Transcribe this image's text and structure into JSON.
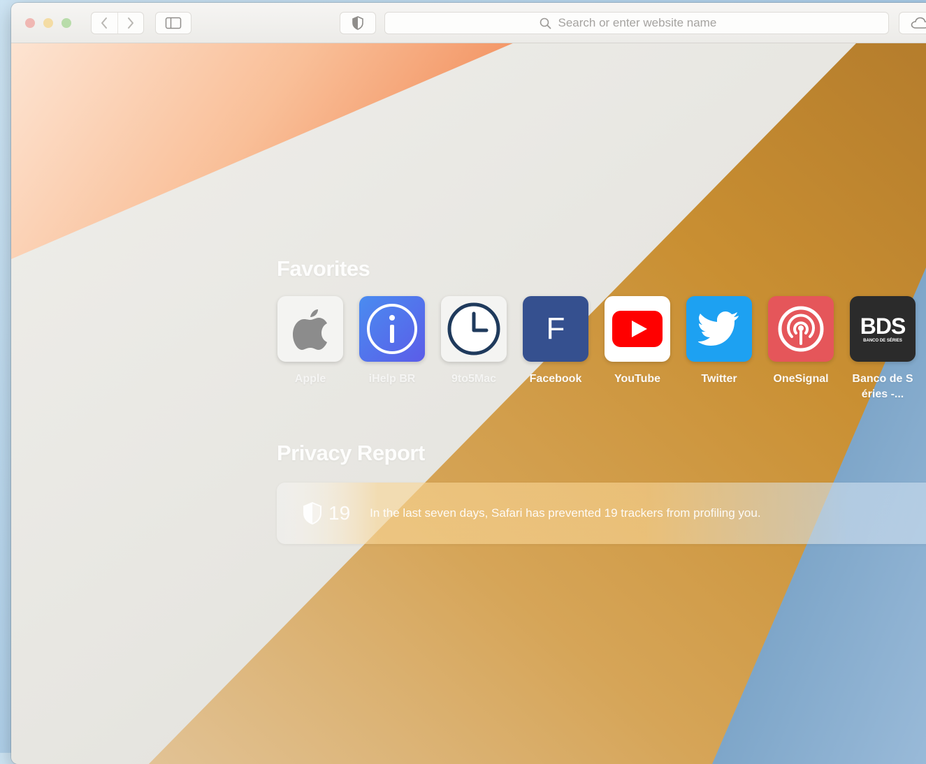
{
  "toolbar": {
    "search_placeholder": "Search or enter website name"
  },
  "favorites": {
    "title": "Favorites",
    "items": [
      {
        "label": "Apple",
        "icon": "apple-logo-icon"
      },
      {
        "label": "iHelp BR",
        "icon": "info-icon"
      },
      {
        "label": "9to5Mac",
        "icon": "clock-icon"
      },
      {
        "label": "Facebook",
        "icon_text": "F"
      },
      {
        "label": "YouTube",
        "icon": "youtube-play-icon"
      },
      {
        "label": "Twitter",
        "icon": "twitter-bird-icon"
      },
      {
        "label": "OneSignal",
        "icon": "broadcast-icon"
      },
      {
        "label": "Banco de Séries -...",
        "icon_text": "BDS",
        "icon_subtext": "BANCO DE SÉRIES"
      }
    ]
  },
  "privacy": {
    "title": "Privacy Report",
    "count": "19",
    "message": "In the last seven days, Safari has prevented 19 trackers from profiling you."
  },
  "colors": {
    "facebook": "#3b5998",
    "youtube": "#ff0000",
    "twitter": "#1da1f2",
    "onesignal": "#e54b4d",
    "bds": "#2b2b2b",
    "wallpaper_orange": "#f4a46f",
    "wallpaper_gold": "#c9922f",
    "wallpaper_blue": "#6f9bc2"
  }
}
